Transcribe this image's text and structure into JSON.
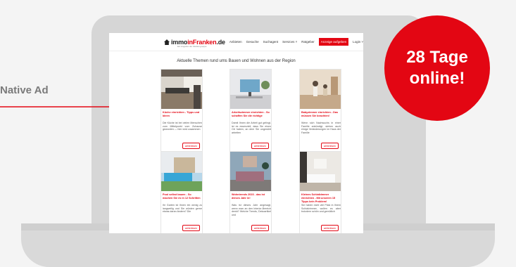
{
  "annotation": {
    "label": "Native Ad"
  },
  "badge": {
    "line1": "28 Tage",
    "line2": "online!"
  },
  "nav": {
    "logo_main": "immo",
    "logo_red": "inFranken",
    "logo_tld": ".de",
    "logo_sub": "Ein Angebot der Mediengruppe",
    "items": [
      "Anbieten",
      "Gesuche",
      "Suchagent",
      "Services ˅",
      "Ratgeber"
    ],
    "cta": "Anzeige aufgeben",
    "login": "Login ˅"
  },
  "section_title": "Aktuelle Themen rund ums Bauen und Wohnen aus der Region",
  "cards": [
    {
      "title": "Küche einrichten - Tipps und Ideen",
      "text": "Die Küche ist bei vielen Menschen zum Mittelpunkt vom Zuhause geworden — hier wird zusammen",
      "button": "weiterlesen"
    },
    {
      "title": "Arbeitszimmer einrichten - So schaffen Sie die richtige",
      "text": "Damit Ihnen die Arbeit gut gelingt, ist es essenziell, dass Sie einen Ort haben, an dem Sie ungestört arbeiten",
      "button": "weiterlesen"
    },
    {
      "title": "Babyzimmer einrichten - Das müssen Sie beachten!",
      "text": "Wenn sich Nachwuchs in einer Familie ankündigt, stehen auch einige Veränderungen im Haus der Familie",
      "button": "weiterlesen"
    },
    {
      "title": "Pool selbst bauen - So machen Sie es in 12 Schritten",
      "text": "Ihr Garten ist Ihnen ein wenig zu langweilig und Sie würden gerne etwas daran ändern? Die",
      "button": "weiterlesen"
    },
    {
      "title": "Wohntrends 2023 - das ist dieses Jahr in!",
      "text": "Was ist dieses Jahr angesagt, wenn man an den Interior-Bereich denkt? Welche Trends, Dekoartikel und",
      "button": "weiterlesen"
    },
    {
      "title": "Kleines Schlafzimmer einrichten - Mit unseren 15 Tipps kein Problem!",
      "text": "Sie haben nicht viel Platz in Ihrem Schlafzimmer, wollen es aber trotzdem schön und gemütlich",
      "button": "weiterlesen"
    }
  ],
  "colors": {
    "brand_red": "#e30613",
    "laptop_frame": "#d6d6d6"
  }
}
